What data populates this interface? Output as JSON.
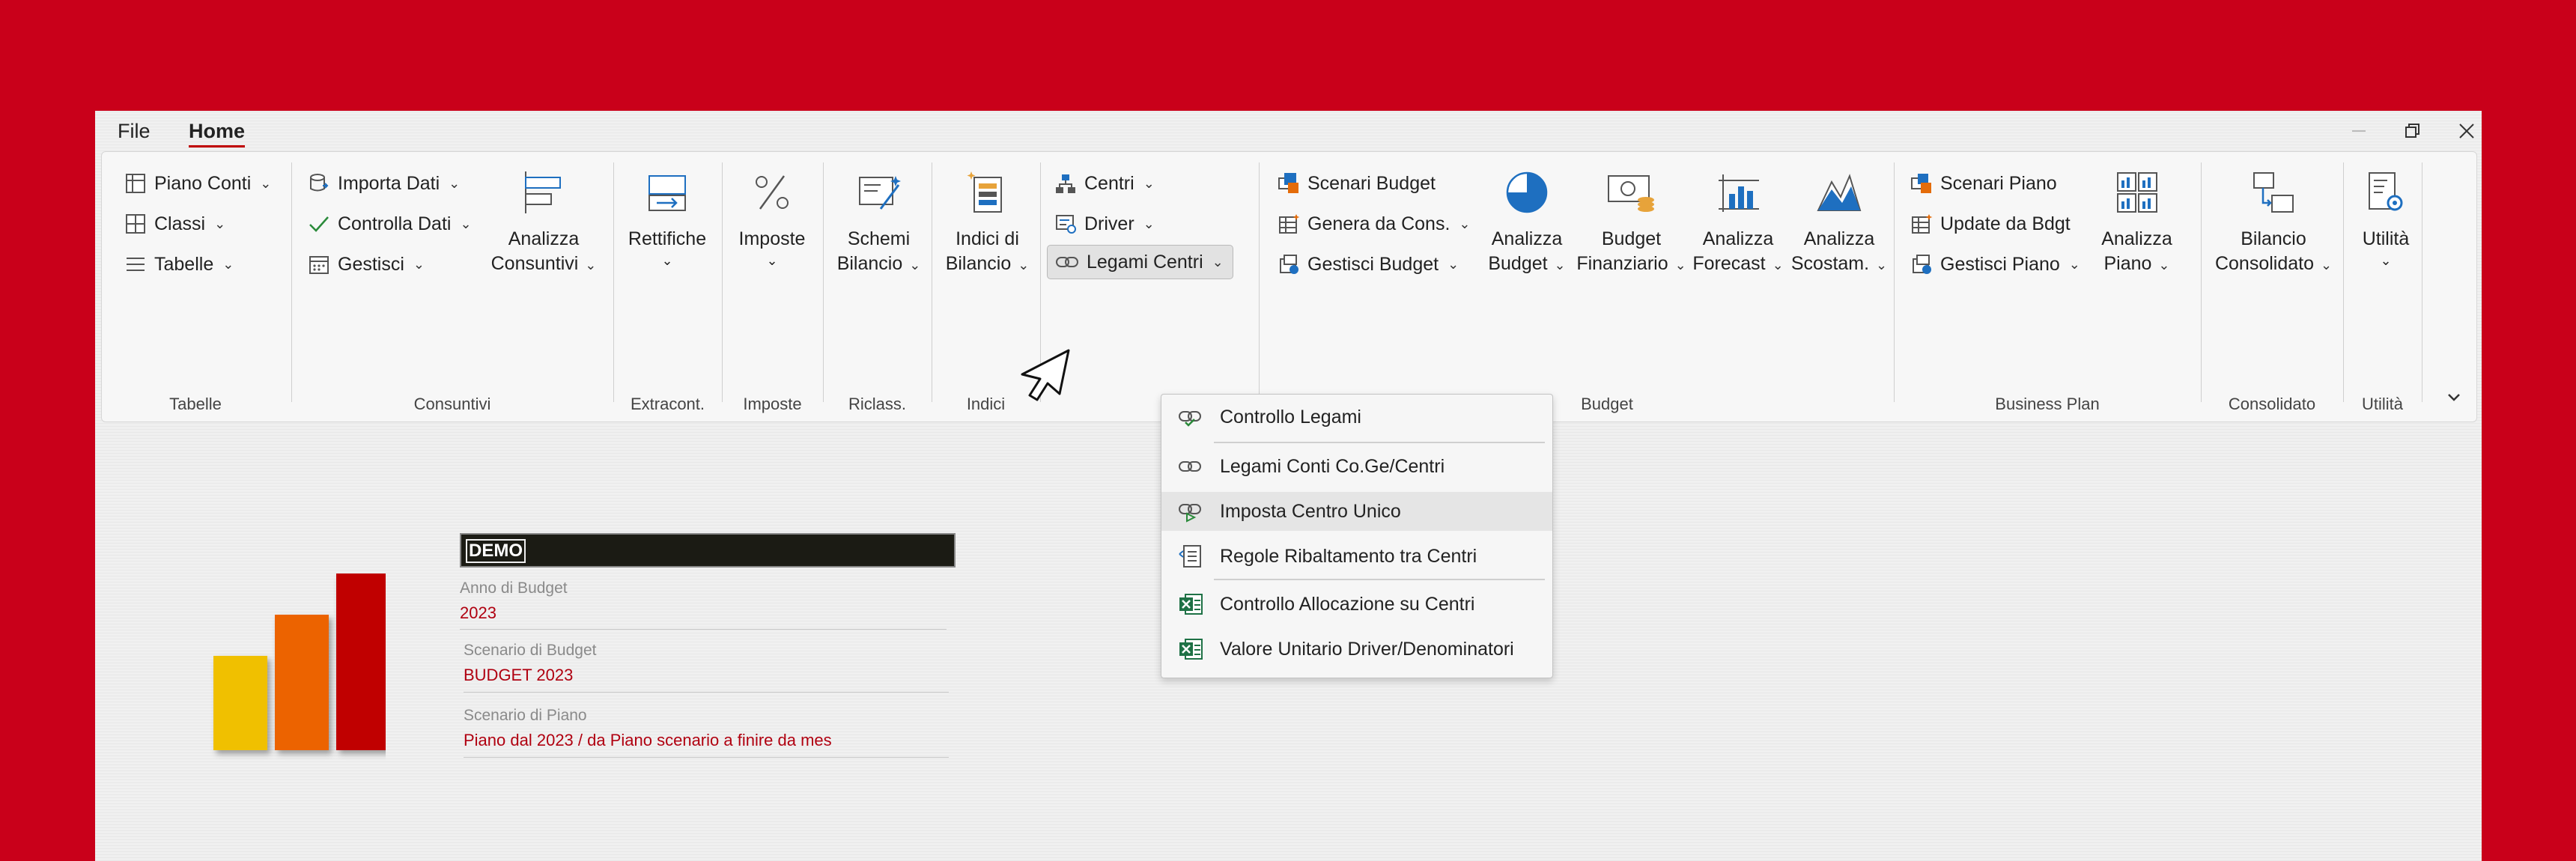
{
  "window": {
    "menu_file": "File",
    "menu_home": "Home"
  },
  "ribbon": {
    "tabelle": {
      "piano_conti": "Piano Conti",
      "classi": "Classi",
      "tabelle": "Tabelle",
      "group": "Tabelle"
    },
    "consuntivi": {
      "importa_dati": "Importa Dati",
      "controlla_dati": "Controlla Dati",
      "gestisci": "Gestisci",
      "analizza_1": "Analizza",
      "analizza_2": "Consuntivi",
      "group": "Consuntivi"
    },
    "extracont": {
      "rettifiche": "Rettifiche",
      "group": "Extracont."
    },
    "imposte": {
      "imposte": "Imposte",
      "group": "Imposte"
    },
    "riclass": {
      "schemi": "Schemi",
      "bilancio": "Bilancio",
      "group": "Riclass."
    },
    "indici": {
      "indici_di": "Indici di",
      "bilancio": "Bilancio",
      "group": "Indici"
    },
    "centri": {
      "centri": "Centri",
      "driver": "Driver",
      "legami_centri": "Legami Centri"
    },
    "budget": {
      "scenari_budget": "Scenari Budget",
      "genera_da_cons": "Genera da Cons.",
      "gestisci_budget": "Gestisci Budget",
      "analizza_budget_1": "Analizza",
      "analizza_budget_2": "Budget",
      "budget_fin_1": "Budget",
      "budget_fin_2": "Finanziario",
      "analizza_forecast_1": "Analizza",
      "analizza_forecast_2": "Forecast",
      "analizza_scostam_1": "Analizza",
      "analizza_scostam_2": "Scostam.",
      "group": "Budget"
    },
    "business_plan": {
      "scenari_piano": "Scenari Piano",
      "update_da_bdgt": "Update da Bdgt",
      "gestisci_piano": "Gestisci Piano",
      "analizza_piano_1": "Analizza",
      "analizza_piano_2": "Piano",
      "group": "Business Plan"
    },
    "consolidato": {
      "bilancio": "Bilancio",
      "consolidato": "Consolidato",
      "group": "Consolidato"
    },
    "utilita": {
      "utilita": "Utilità",
      "group": "Utilità"
    }
  },
  "dropdown": {
    "items": [
      "Controllo Legami",
      "Legami Conti Co.Ge/Centri",
      "Imposta Centro Unico",
      "Regole Ribaltamento tra Centri",
      "Controllo Allocazione su Centri",
      "Valore Unitario Driver/Denominatori"
    ]
  },
  "info": {
    "company": "DEMO",
    "anno_label": "Anno di Budget",
    "anno_value": "2023",
    "scenario_budget_label": "Scenario di Budget",
    "scenario_budget_value": "BUDGET 2023",
    "scenario_piano_label": "Scenario di Piano",
    "scenario_piano_value": "Piano dal 2023 / da Piano scenario a finire da mes"
  },
  "colors": {
    "background": "#c9001a",
    "accent": "#c00000",
    "bar_yellow": "#f0c000",
    "bar_orange": "#ec6400",
    "bar_red": "#c00000",
    "value_text": "#b00010",
    "excel_green": "#1e7145"
  },
  "icons": {
    "close": "close-icon",
    "restore": "restore-icon",
    "minimize": "minimize-icon",
    "collapse": "chevron-down-icon",
    "cursor": "mouse-pointer-icon"
  }
}
